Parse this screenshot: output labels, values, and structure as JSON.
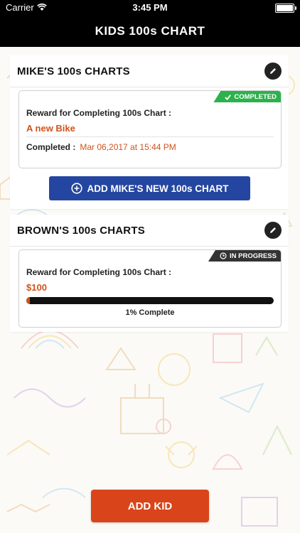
{
  "status_bar": {
    "carrier": "Carrier",
    "time": "3:45 PM"
  },
  "nav": {
    "title": "KIDS 100s CHART"
  },
  "colors": {
    "accent": "#d0531d",
    "completed": "#2bb24c",
    "in_progress": "#333333",
    "primary_button": "#2446a0",
    "add_kid": "#d9441a"
  },
  "kids": [
    {
      "title": "MIKE'S 100s CHARTS",
      "chart": {
        "status": "COMPLETED",
        "status_icon": "check-icon",
        "reward_label": "Reward for Completing 100s Chart :",
        "reward": "A new Bike",
        "completed_label": "Completed :",
        "completed_date": "Mar 06,2017 at 15:44 PM"
      },
      "add_button_label": "ADD MIKE'S NEW 100s CHART"
    },
    {
      "title": "BROWN'S 100s CHARTS",
      "chart": {
        "status": "IN PROGRESS",
        "status_icon": "clock-icon",
        "reward_label": "Reward for Completing 100s Chart :",
        "reward": "$100",
        "progress_percent": 1,
        "progress_text": "1% Complete"
      }
    }
  ],
  "add_kid_label": "ADD KID"
}
